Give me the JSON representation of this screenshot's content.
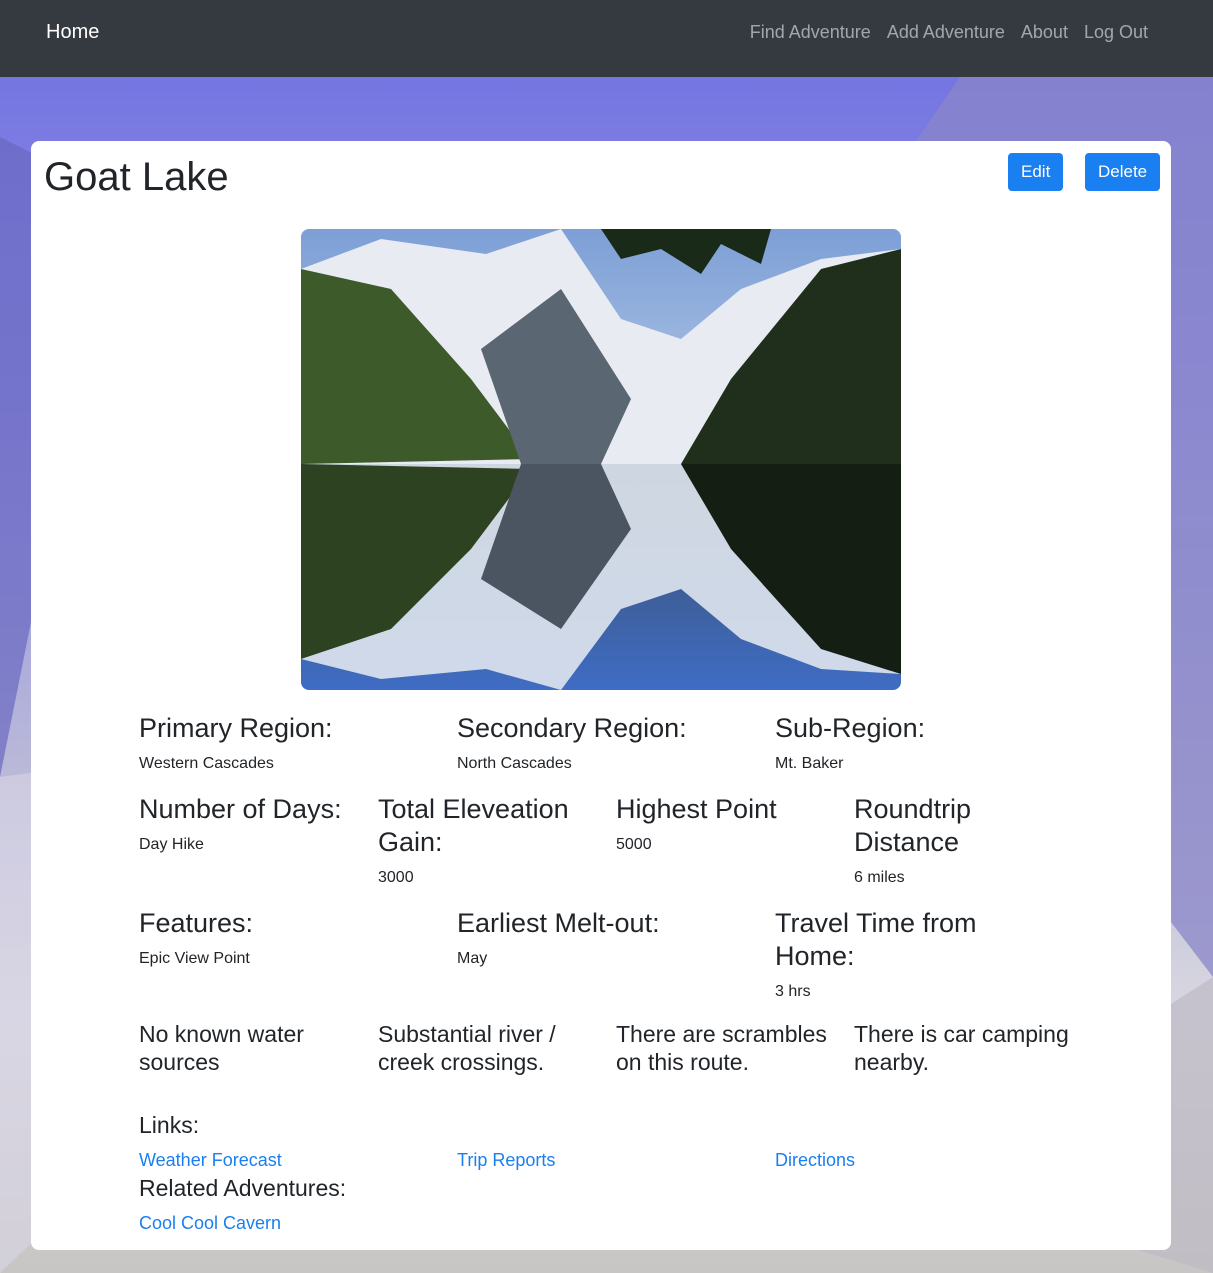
{
  "nav": {
    "brand": "Home",
    "links": [
      "Find Adventure",
      "Add Adventure",
      "About",
      "Log Out"
    ]
  },
  "adventure": {
    "title": "Goat Lake",
    "edit_label": "Edit",
    "delete_label": "Delete",
    "fields": {
      "primary_region": {
        "label": "Primary Region:",
        "value": "Western Cascades"
      },
      "secondary_region": {
        "label": "Secondary Region:",
        "value": "North Cascades"
      },
      "sub_region": {
        "label": "Sub-Region:",
        "value": "Mt. Baker"
      },
      "number_of_days": {
        "label": "Number of Days:",
        "value": "Day Hike"
      },
      "elevation_gain": {
        "label": "Total Eleveation Gain:",
        "value": "3000"
      },
      "highest_point": {
        "label": "Highest Point",
        "value": "5000"
      },
      "roundtrip_distance": {
        "label": "Roundtrip Distance",
        "value": "6 miles"
      },
      "features": {
        "label": "Features:",
        "value": "Epic View Point"
      },
      "earliest_meltout": {
        "label": "Earliest Melt-out:",
        "value": "May"
      },
      "travel_time": {
        "label": "Travel Time from Home:",
        "value": "3 hrs"
      }
    },
    "flags": [
      "No known water sources",
      "Substantial river / creek crossings.",
      "There are scrambles on this route.",
      "There is car camping nearby."
    ],
    "links_label": "Links:",
    "links": [
      "Weather Forecast",
      "Trip Reports",
      "Directions"
    ],
    "related_label": "Related Adventures:",
    "related": [
      "Cool Cool Cavern"
    ]
  },
  "colors": {
    "navbar": "#343a40",
    "primary": "#1a7ff0",
    "link": "#1a7ff0"
  }
}
